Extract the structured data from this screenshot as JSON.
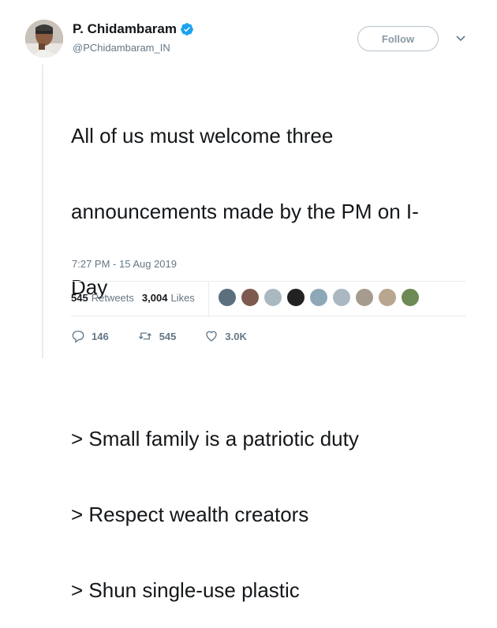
{
  "user": {
    "name": "P. Chidambaram",
    "handle": "@PChidambaram_IN"
  },
  "follow_label": "Follow",
  "tweet": {
    "lines": [
      "All of us must welcome three",
      "announcements made by the PM on I-",
      "Day",
      "",
      "> Small family is a patriotic duty",
      "> Respect wealth creators",
      "> Shun single-use plastic"
    ],
    "timestamp": "7:27 PM - 15 Aug 2019"
  },
  "stats": {
    "retweets_count": "545",
    "retweets_label": "Retweets",
    "likes_count": "3,004",
    "likes_label": "Likes"
  },
  "liker_colors": [
    "#5b6f7d",
    "#7d5a4f",
    "#aab8c2",
    "#222222",
    "#8fa8b8",
    "#aab8c2",
    "#a59c8f",
    "#b9a68e",
    "#6d8a55"
  ],
  "actions": {
    "replies": "146",
    "retweets": "545",
    "likes": "3.0K"
  },
  "colors": {
    "verified_badge": "#1da1f2",
    "muted_text": "#657786",
    "primary_text": "#14171a"
  },
  "icons": [
    "verified-badge-icon",
    "chevron-down-icon",
    "reply-icon",
    "retweet-icon",
    "like-icon"
  ]
}
